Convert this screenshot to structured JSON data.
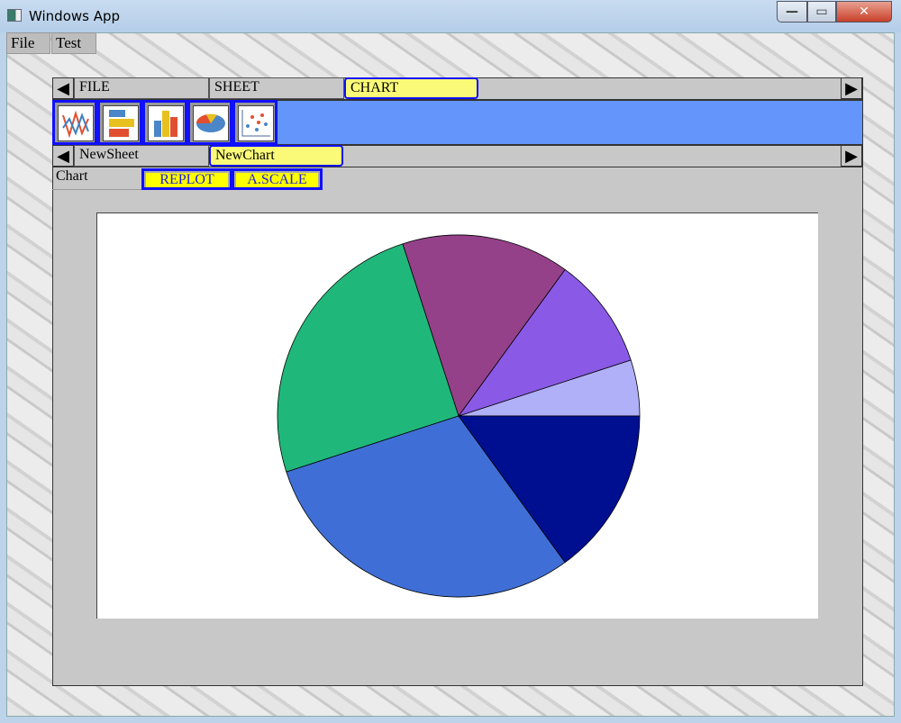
{
  "window": {
    "title": "Windows App",
    "minimize": "—",
    "maximize": "▭",
    "close": "✕"
  },
  "menu": [
    {
      "label": "File"
    },
    {
      "label": "Test"
    }
  ],
  "tabs": {
    "left": "◀",
    "right": "▶",
    "items": [
      {
        "label": "FILE"
      },
      {
        "label": "SHEET"
      },
      {
        "label": "CHART",
        "selected": true
      }
    ]
  },
  "toolbar": {
    "color": "#6495fa",
    "icons": [
      "line-chart-icon",
      "horizontal-bar-chart-icon",
      "bar-chart-icon",
      "pie-chart-icon",
      "scatter-chart-icon"
    ]
  },
  "sheets": {
    "left": "◀",
    "right": "▶",
    "items": [
      {
        "label": "NewSheet"
      },
      {
        "label": "NewChart",
        "selected": true
      }
    ]
  },
  "panel": {
    "label": "Chart",
    "replot": "REPLOT",
    "autoscale": "A.SCALE"
  },
  "chart_data": {
    "type": "pie",
    "title": "",
    "start_angle_deg": 0,
    "direction": "counterclockwise",
    "values": [
      5,
      10,
      15,
      25,
      30,
      15
    ],
    "colors": [
      "#b0b0f8",
      "#8a5ae6",
      "#944189",
      "#20b87a",
      "#3f6fd6",
      "#000f90"
    ]
  }
}
